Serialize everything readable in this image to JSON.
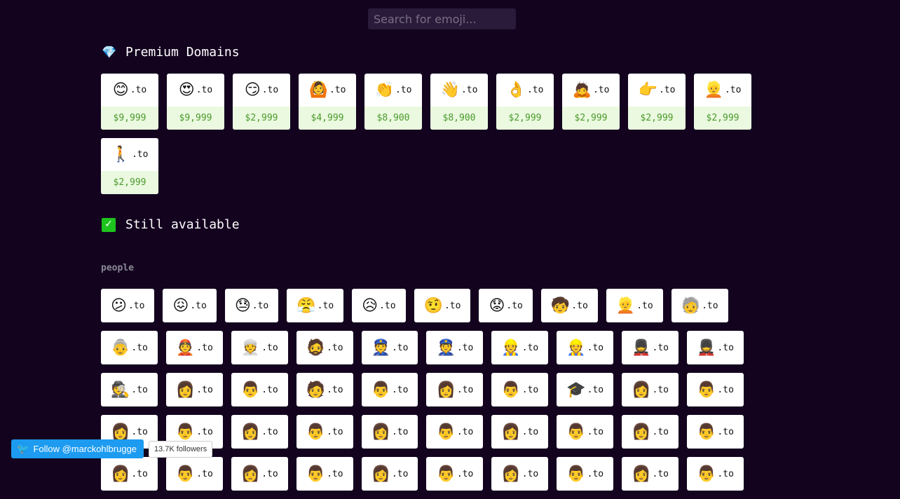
{
  "search": {
    "placeholder": "Search for emoji..."
  },
  "premium": {
    "title": "Premium Domains",
    "icon": "gem-icon",
    "items": [
      {
        "emoji": "😊",
        "tld": ".to",
        "price": "$9,999"
      },
      {
        "emoji": "😍",
        "tld": ".to",
        "price": "$9,999"
      },
      {
        "emoji": "😏",
        "tld": ".to",
        "price": "$2,999"
      },
      {
        "emoji": "🙆",
        "tld": ".to",
        "price": "$4,999"
      },
      {
        "emoji": "👏",
        "tld": ".to",
        "price": "$8,900"
      },
      {
        "emoji": "👋",
        "tld": ".to",
        "price": "$8,900"
      },
      {
        "emoji": "👌",
        "tld": ".to",
        "price": "$2,999"
      },
      {
        "emoji": "🙇",
        "tld": ".to",
        "price": "$2,999"
      },
      {
        "emoji": "👉",
        "tld": ".to",
        "price": "$2,999"
      },
      {
        "emoji": "👱",
        "tld": ".to",
        "price": "$2,999"
      },
      {
        "emoji": "🚶",
        "tld": ".to",
        "price": "$2,999"
      }
    ]
  },
  "available": {
    "title": "Still available",
    "icon": "check-icon",
    "category": "people",
    "rows": [
      [
        {
          "emoji": "😕",
          "tld": ".to"
        },
        {
          "emoji": "😖",
          "tld": ".to"
        },
        {
          "emoji": "😓",
          "tld": ".to"
        },
        {
          "emoji": "😤",
          "tld": ".to"
        },
        {
          "emoji": "😥",
          "tld": ".to"
        },
        {
          "emoji": "🤨",
          "tld": ".to"
        },
        {
          "emoji": "😟",
          "tld": ".to"
        },
        {
          "emoji": "🧒",
          "tld": ".to"
        },
        {
          "emoji": "👱",
          "tld": ".to"
        },
        {
          "emoji": "🧓",
          "tld": ".to"
        }
      ],
      [
        {
          "emoji": "👵",
          "tld": ".to"
        },
        {
          "emoji": "👲",
          "tld": ".to"
        },
        {
          "emoji": "👳",
          "tld": ".to"
        },
        {
          "emoji": "🧔",
          "tld": ".to"
        },
        {
          "emoji": "👮",
          "tld": ".to"
        },
        {
          "emoji": "👮",
          "tld": ".to"
        },
        {
          "emoji": "👷",
          "tld": ".to"
        },
        {
          "emoji": "👷",
          "tld": ".to"
        },
        {
          "emoji": "💂",
          "tld": ".to"
        },
        {
          "emoji": "💂",
          "tld": ".to"
        }
      ],
      [
        {
          "emoji": "🕵",
          "tld": ".to"
        },
        {
          "emoji": "👩",
          "tld": ".to"
        },
        {
          "emoji": "👨",
          "tld": ".to"
        },
        {
          "emoji": "🧑",
          "tld": ".to"
        },
        {
          "emoji": "👨",
          "tld": ".to"
        },
        {
          "emoji": "👩",
          "tld": ".to"
        },
        {
          "emoji": "👨",
          "tld": ".to"
        },
        {
          "emoji": "🎓",
          "tld": ".to"
        },
        {
          "emoji": "👩",
          "tld": ".to"
        },
        {
          "emoji": "👨",
          "tld": ".to"
        }
      ],
      [
        {
          "emoji": "👩",
          "tld": ".to"
        },
        {
          "emoji": "👨",
          "tld": ".to"
        },
        {
          "emoji": "👩",
          "tld": ".to"
        },
        {
          "emoji": "👨",
          "tld": ".to"
        },
        {
          "emoji": "👩",
          "tld": ".to"
        },
        {
          "emoji": "👨",
          "tld": ".to"
        },
        {
          "emoji": "👩",
          "tld": ".to"
        },
        {
          "emoji": "👨",
          "tld": ".to"
        },
        {
          "emoji": "👩",
          "tld": ".to"
        },
        {
          "emoji": "👨",
          "tld": ".to"
        }
      ],
      [
        {
          "emoji": "👩",
          "tld": ".to"
        },
        {
          "emoji": "👨",
          "tld": ".to"
        },
        {
          "emoji": "👩",
          "tld": ".to"
        },
        {
          "emoji": "👨",
          "tld": ".to"
        },
        {
          "emoji": "👩",
          "tld": ".to"
        },
        {
          "emoji": "👨",
          "tld": ".to"
        },
        {
          "emoji": "👩",
          "tld": ".to"
        },
        {
          "emoji": "👨",
          "tld": ".to"
        },
        {
          "emoji": "👩",
          "tld": ".to"
        },
        {
          "emoji": "👨",
          "tld": ".to"
        }
      ]
    ]
  },
  "twitter": {
    "follow_label": "Follow @marckohlbrugge",
    "followers": "13.7K followers",
    "icon": "twitter-bird-icon"
  }
}
